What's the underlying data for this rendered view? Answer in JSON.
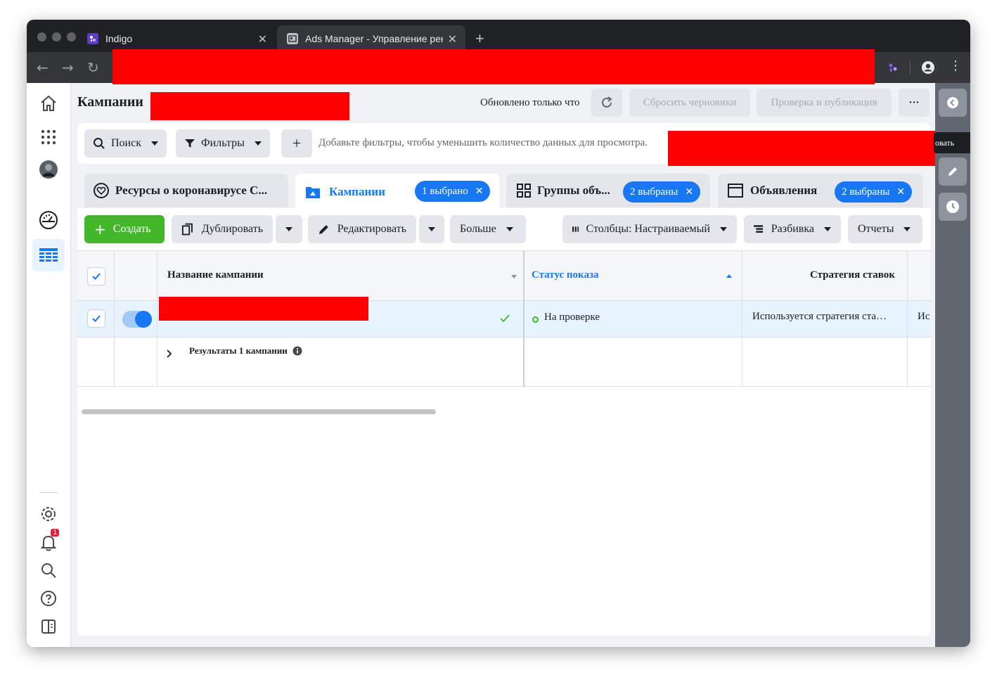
{
  "browser": {
    "tabs": [
      {
        "title": "Indigo",
        "close": "✕"
      },
      {
        "title": "Ads Manager - Управление рек",
        "close": "✕"
      }
    ],
    "new_tab": "+"
  },
  "header": {
    "title": "Кампании",
    "updated_text": "Обновлено только что",
    "discard_label": "Сбросить черновики",
    "publish_label": "Проверка и публикация",
    "more_label": "···"
  },
  "filterbar": {
    "search_label": "Поиск",
    "filters_label": "Фильтры",
    "add_label": "+",
    "hint": "Добавьте фильтры, чтобы уменьшить количество данных для просмотра."
  },
  "tooltip": "овать",
  "level_tabs": [
    {
      "label": "Ресурсы о коронавирусе С...",
      "badge": ""
    },
    {
      "label": "Кампании",
      "badge": "1 выбрано"
    },
    {
      "label": "Группы объ...",
      "badge": "2 выбраны"
    },
    {
      "label": "Объявления",
      "badge": "2 выбраны"
    }
  ],
  "actions": {
    "create": "Создать",
    "duplicate": "Дублировать",
    "edit": "Редактировать",
    "more": "Больше",
    "columns": "Столбцы: Настраиваемый",
    "breakdown": "Разбивка",
    "reports": "Отчеты"
  },
  "table": {
    "columns": [
      "Название кампании",
      "Статус показа",
      "Стратегия ставок"
    ],
    "row": {
      "status": "На проверке",
      "strategy": "Используется стратегия ста…",
      "truncated": "Ис"
    },
    "footer": "Результаты 1 кампании"
  },
  "notifications_count": "1",
  "colors": {
    "accent": "#1877f2",
    "create_green": "#42b72a",
    "status_green": "#42b72a",
    "redaction": "#ff0000"
  }
}
